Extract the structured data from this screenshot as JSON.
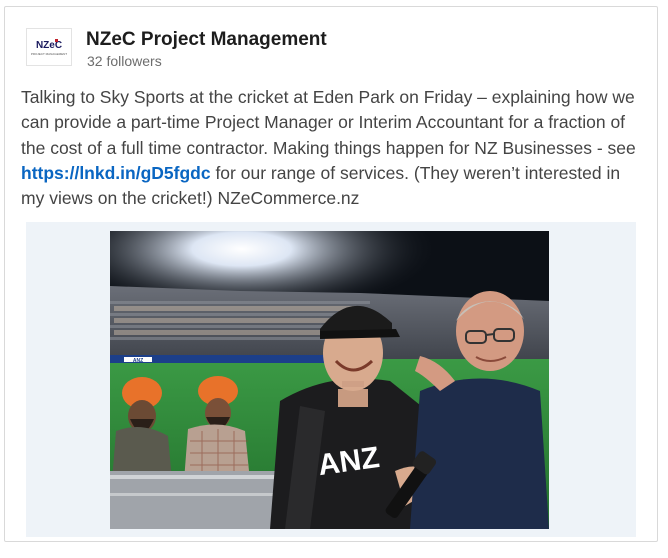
{
  "company": {
    "logo_text": "NZeC",
    "logo_subtext": "PROJECT MANAGEMENT",
    "name": "NZeC Project Management",
    "followers": "32 followers"
  },
  "post": {
    "line1": "Talking to Sky Sports at the cricket at Eden Park on Friday – explaining how we",
    "line2": "can provide a part-time Project Manager or Interim Accountant for a fraction of",
    "line3": "the cost of a full time contractor. Making things happen for NZ Businesses - see",
    "link": "https://lnkd.in/gD5fgdc",
    "line4_rest": " for our range of services. (They weren’t interested in",
    "line5": "my views on the cricket!) NZeCommerce.nz"
  },
  "photo": {
    "shirt_text": "ANZ",
    "board_text": "ANZ",
    "colors": {
      "night_sky": "#0c1016",
      "pitch": "#2e8a3a",
      "turban": "#e8722a",
      "shirt": "#1c1c1e",
      "shirt_blue": "#1e2c4a"
    }
  }
}
